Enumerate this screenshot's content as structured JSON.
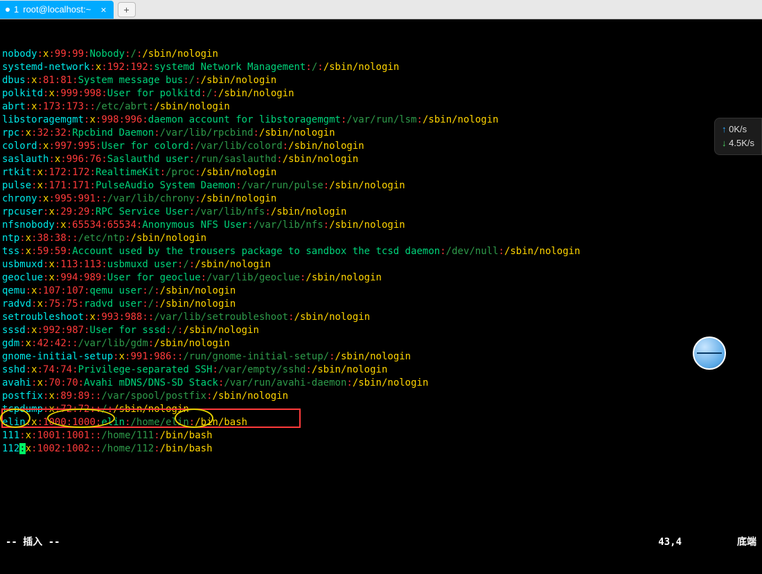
{
  "tab": {
    "index": "1",
    "title": "root@localhost:~",
    "close": "×",
    "plus": "+"
  },
  "lines": [
    [
      [
        "nobody",
        "cyan"
      ],
      [
        ":",
        "red"
      ],
      [
        "x",
        "yellow"
      ],
      [
        ":",
        "red"
      ],
      [
        "99",
        "red"
      ],
      [
        ":",
        "red"
      ],
      [
        "99",
        "red"
      ],
      [
        ":",
        "red"
      ],
      [
        "Nobody",
        "green"
      ],
      [
        ":",
        "red"
      ],
      [
        "/",
        "dgreen"
      ],
      [
        ":",
        "red"
      ],
      [
        "/sbin/nologin",
        "yellow"
      ]
    ],
    [
      [
        "systemd-network",
        "cyan"
      ],
      [
        ":",
        "red"
      ],
      [
        "x",
        "yellow"
      ],
      [
        ":",
        "red"
      ],
      [
        "192",
        "red"
      ],
      [
        ":",
        "red"
      ],
      [
        "192",
        "red"
      ],
      [
        ":",
        "red"
      ],
      [
        "systemd Network Management",
        "green"
      ],
      [
        ":",
        "red"
      ],
      [
        "/",
        "dgreen"
      ],
      [
        ":",
        "red"
      ],
      [
        "/sbin/nologin",
        "yellow"
      ]
    ],
    [
      [
        "dbus",
        "cyan"
      ],
      [
        ":",
        "red"
      ],
      [
        "x",
        "yellow"
      ],
      [
        ":",
        "red"
      ],
      [
        "81",
        "red"
      ],
      [
        ":",
        "red"
      ],
      [
        "81",
        "red"
      ],
      [
        ":",
        "red"
      ],
      [
        "System message bus",
        "green"
      ],
      [
        ":",
        "red"
      ],
      [
        "/",
        "dgreen"
      ],
      [
        ":",
        "red"
      ],
      [
        "/sbin/nologin",
        "yellow"
      ]
    ],
    [
      [
        "polkitd",
        "cyan"
      ],
      [
        ":",
        "red"
      ],
      [
        "x",
        "yellow"
      ],
      [
        ":",
        "red"
      ],
      [
        "999",
        "red"
      ],
      [
        ":",
        "red"
      ],
      [
        "998",
        "red"
      ],
      [
        ":",
        "red"
      ],
      [
        "User for polkitd",
        "green"
      ],
      [
        ":",
        "red"
      ],
      [
        "/",
        "dgreen"
      ],
      [
        ":",
        "red"
      ],
      [
        "/sbin/nologin",
        "yellow"
      ]
    ],
    [
      [
        "abrt",
        "cyan"
      ],
      [
        ":",
        "red"
      ],
      [
        "x",
        "yellow"
      ],
      [
        ":",
        "red"
      ],
      [
        "173",
        "red"
      ],
      [
        ":",
        "red"
      ],
      [
        "173",
        "red"
      ],
      [
        ":",
        "red"
      ],
      [
        ":",
        "red"
      ],
      [
        "/etc/abrt",
        "dgreen"
      ],
      [
        ":",
        "red"
      ],
      [
        "/sbin/nologin",
        "yellow"
      ]
    ],
    [
      [
        "libstoragemgmt",
        "cyan"
      ],
      [
        ":",
        "red"
      ],
      [
        "x",
        "yellow"
      ],
      [
        ":",
        "red"
      ],
      [
        "998",
        "red"
      ],
      [
        ":",
        "red"
      ],
      [
        "996",
        "red"
      ],
      [
        ":",
        "red"
      ],
      [
        "daemon account for libstoragemgmt",
        "green"
      ],
      [
        ":",
        "red"
      ],
      [
        "/var/run/lsm",
        "dgreen"
      ],
      [
        ":",
        "red"
      ],
      [
        "/sbin/nologin",
        "yellow"
      ]
    ],
    [
      [
        "rpc",
        "cyan"
      ],
      [
        ":",
        "red"
      ],
      [
        "x",
        "yellow"
      ],
      [
        ":",
        "red"
      ],
      [
        "32",
        "red"
      ],
      [
        ":",
        "red"
      ],
      [
        "32",
        "red"
      ],
      [
        ":",
        "red"
      ],
      [
        "Rpcbind Daemon",
        "green"
      ],
      [
        ":",
        "red"
      ],
      [
        "/var/lib/rpcbind",
        "dgreen"
      ],
      [
        ":",
        "red"
      ],
      [
        "/sbin/nologin",
        "yellow"
      ]
    ],
    [
      [
        "colord",
        "cyan"
      ],
      [
        ":",
        "red"
      ],
      [
        "x",
        "yellow"
      ],
      [
        ":",
        "red"
      ],
      [
        "997",
        "red"
      ],
      [
        ":",
        "red"
      ],
      [
        "995",
        "red"
      ],
      [
        ":",
        "red"
      ],
      [
        "User for colord",
        "green"
      ],
      [
        ":",
        "red"
      ],
      [
        "/var/lib/colord",
        "dgreen"
      ],
      [
        ":",
        "red"
      ],
      [
        "/sbin/nologin",
        "yellow"
      ]
    ],
    [
      [
        "saslauth",
        "cyan"
      ],
      [
        ":",
        "red"
      ],
      [
        "x",
        "yellow"
      ],
      [
        ":",
        "red"
      ],
      [
        "996",
        "red"
      ],
      [
        ":",
        "red"
      ],
      [
        "76",
        "red"
      ],
      [
        ":",
        "red"
      ],
      [
        "Saslauthd user",
        "green"
      ],
      [
        ":",
        "red"
      ],
      [
        "/run/saslauthd",
        "dgreen"
      ],
      [
        ":",
        "red"
      ],
      [
        "/sbin/nologin",
        "yellow"
      ]
    ],
    [
      [
        "rtkit",
        "cyan"
      ],
      [
        ":",
        "red"
      ],
      [
        "x",
        "yellow"
      ],
      [
        ":",
        "red"
      ],
      [
        "172",
        "red"
      ],
      [
        ":",
        "red"
      ],
      [
        "172",
        "red"
      ],
      [
        ":",
        "red"
      ],
      [
        "RealtimeKit",
        "green"
      ],
      [
        ":",
        "red"
      ],
      [
        "/proc",
        "dgreen"
      ],
      [
        ":",
        "red"
      ],
      [
        "/sbin/nologin",
        "yellow"
      ]
    ],
    [
      [
        "pulse",
        "cyan"
      ],
      [
        ":",
        "red"
      ],
      [
        "x",
        "yellow"
      ],
      [
        ":",
        "red"
      ],
      [
        "171",
        "red"
      ],
      [
        ":",
        "red"
      ],
      [
        "171",
        "red"
      ],
      [
        ":",
        "red"
      ],
      [
        "PulseAudio System Daemon",
        "green"
      ],
      [
        ":",
        "red"
      ],
      [
        "/var/run/pulse",
        "dgreen"
      ],
      [
        ":",
        "red"
      ],
      [
        "/sbin/nologin",
        "yellow"
      ]
    ],
    [
      [
        "chrony",
        "cyan"
      ],
      [
        ":",
        "red"
      ],
      [
        "x",
        "yellow"
      ],
      [
        ":",
        "red"
      ],
      [
        "995",
        "red"
      ],
      [
        ":",
        "red"
      ],
      [
        "991",
        "red"
      ],
      [
        ":",
        "red"
      ],
      [
        ":",
        "red"
      ],
      [
        "/var/lib/chrony",
        "dgreen"
      ],
      [
        ":",
        "red"
      ],
      [
        "/sbin/nologin",
        "yellow"
      ]
    ],
    [
      [
        "rpcuser",
        "cyan"
      ],
      [
        ":",
        "red"
      ],
      [
        "x",
        "yellow"
      ],
      [
        ":",
        "red"
      ],
      [
        "29",
        "red"
      ],
      [
        ":",
        "red"
      ],
      [
        "29",
        "red"
      ],
      [
        ":",
        "red"
      ],
      [
        "RPC Service User",
        "green"
      ],
      [
        ":",
        "red"
      ],
      [
        "/var/lib/nfs",
        "dgreen"
      ],
      [
        ":",
        "red"
      ],
      [
        "/sbin/nologin",
        "yellow"
      ]
    ],
    [
      [
        "nfsnobody",
        "cyan"
      ],
      [
        ":",
        "red"
      ],
      [
        "x",
        "yellow"
      ],
      [
        ":",
        "red"
      ],
      [
        "65534",
        "red"
      ],
      [
        ":",
        "red"
      ],
      [
        "65534",
        "red"
      ],
      [
        ":",
        "red"
      ],
      [
        "Anonymous NFS User",
        "green"
      ],
      [
        ":",
        "red"
      ],
      [
        "/var/lib/nfs",
        "dgreen"
      ],
      [
        ":",
        "red"
      ],
      [
        "/sbin/nologin",
        "yellow"
      ]
    ],
    [
      [
        "ntp",
        "cyan"
      ],
      [
        ":",
        "red"
      ],
      [
        "x",
        "yellow"
      ],
      [
        ":",
        "red"
      ],
      [
        "38",
        "red"
      ],
      [
        ":",
        "red"
      ],
      [
        "38",
        "red"
      ],
      [
        ":",
        "red"
      ],
      [
        ":",
        "red"
      ],
      [
        "/etc/ntp",
        "dgreen"
      ],
      [
        ":",
        "red"
      ],
      [
        "/sbin/nologin",
        "yellow"
      ]
    ],
    [
      [
        "tss",
        "cyan"
      ],
      [
        ":",
        "red"
      ],
      [
        "x",
        "yellow"
      ],
      [
        ":",
        "red"
      ],
      [
        "59",
        "red"
      ],
      [
        ":",
        "red"
      ],
      [
        "59",
        "red"
      ],
      [
        ":",
        "red"
      ],
      [
        "Account used by the trousers package to sandbox the tcsd daemon",
        "green"
      ],
      [
        ":",
        "red"
      ],
      [
        "/dev/null",
        "dgreen"
      ],
      [
        ":",
        "red"
      ],
      [
        "/sbin/nologin",
        "yellow"
      ]
    ],
    [
      [
        "usbmuxd",
        "cyan"
      ],
      [
        ":",
        "red"
      ],
      [
        "x",
        "yellow"
      ],
      [
        ":",
        "red"
      ],
      [
        "113",
        "red"
      ],
      [
        ":",
        "red"
      ],
      [
        "113",
        "red"
      ],
      [
        ":",
        "red"
      ],
      [
        "usbmuxd user",
        "green"
      ],
      [
        ":",
        "red"
      ],
      [
        "/",
        "dgreen"
      ],
      [
        ":",
        "red"
      ],
      [
        "/sbin/nologin",
        "yellow"
      ]
    ],
    [
      [
        "geoclue",
        "cyan"
      ],
      [
        ":",
        "red"
      ],
      [
        "x",
        "yellow"
      ],
      [
        ":",
        "red"
      ],
      [
        "994",
        "red"
      ],
      [
        ":",
        "red"
      ],
      [
        "989",
        "red"
      ],
      [
        ":",
        "red"
      ],
      [
        "User for geoclue",
        "green"
      ],
      [
        ":",
        "red"
      ],
      [
        "/var/lib/geoclue",
        "dgreen"
      ],
      [
        ":",
        "red"
      ],
      [
        "/sbin/nologin",
        "yellow"
      ]
    ],
    [
      [
        "qemu",
        "cyan"
      ],
      [
        ":",
        "red"
      ],
      [
        "x",
        "yellow"
      ],
      [
        ":",
        "red"
      ],
      [
        "107",
        "red"
      ],
      [
        ":",
        "red"
      ],
      [
        "107",
        "red"
      ],
      [
        ":",
        "red"
      ],
      [
        "qemu user",
        "green"
      ],
      [
        ":",
        "red"
      ],
      [
        "/",
        "dgreen"
      ],
      [
        ":",
        "red"
      ],
      [
        "/sbin/nologin",
        "yellow"
      ]
    ],
    [
      [
        "radvd",
        "cyan"
      ],
      [
        ":",
        "red"
      ],
      [
        "x",
        "yellow"
      ],
      [
        ":",
        "red"
      ],
      [
        "75",
        "red"
      ],
      [
        ":",
        "red"
      ],
      [
        "75",
        "red"
      ],
      [
        ":",
        "red"
      ],
      [
        "radvd user",
        "green"
      ],
      [
        ":",
        "red"
      ],
      [
        "/",
        "dgreen"
      ],
      [
        ":",
        "red"
      ],
      [
        "/sbin/nologin",
        "yellow"
      ]
    ],
    [
      [
        "setroubleshoot",
        "cyan"
      ],
      [
        ":",
        "red"
      ],
      [
        "x",
        "yellow"
      ],
      [
        ":",
        "red"
      ],
      [
        "993",
        "red"
      ],
      [
        ":",
        "red"
      ],
      [
        "988",
        "red"
      ],
      [
        ":",
        "red"
      ],
      [
        ":",
        "red"
      ],
      [
        "/var/lib/setroubleshoot",
        "dgreen"
      ],
      [
        ":",
        "red"
      ],
      [
        "/sbin/nologin",
        "yellow"
      ]
    ],
    [
      [
        "sssd",
        "cyan"
      ],
      [
        ":",
        "red"
      ],
      [
        "x",
        "yellow"
      ],
      [
        ":",
        "red"
      ],
      [
        "992",
        "red"
      ],
      [
        ":",
        "red"
      ],
      [
        "987",
        "red"
      ],
      [
        ":",
        "red"
      ],
      [
        "User for sssd",
        "green"
      ],
      [
        ":",
        "red"
      ],
      [
        "/",
        "dgreen"
      ],
      [
        ":",
        "red"
      ],
      [
        "/sbin/nologin",
        "yellow"
      ]
    ],
    [
      [
        "gdm",
        "cyan"
      ],
      [
        ":",
        "red"
      ],
      [
        "x",
        "yellow"
      ],
      [
        ":",
        "red"
      ],
      [
        "42",
        "red"
      ],
      [
        ":",
        "red"
      ],
      [
        "42",
        "red"
      ],
      [
        ":",
        "red"
      ],
      [
        ":",
        "red"
      ],
      [
        "/var/lib/gdm",
        "dgreen"
      ],
      [
        ":",
        "red"
      ],
      [
        "/sbin/nologin",
        "yellow"
      ]
    ],
    [
      [
        "gnome-initial-setup",
        "cyan"
      ],
      [
        ":",
        "red"
      ],
      [
        "x",
        "yellow"
      ],
      [
        ":",
        "red"
      ],
      [
        "991",
        "red"
      ],
      [
        ":",
        "red"
      ],
      [
        "986",
        "red"
      ],
      [
        ":",
        "red"
      ],
      [
        ":",
        "red"
      ],
      [
        "/run/gnome-initial-setup/",
        "dgreen"
      ],
      [
        ":",
        "red"
      ],
      [
        "/sbin/nologin",
        "yellow"
      ]
    ],
    [
      [
        "sshd",
        "cyan"
      ],
      [
        ":",
        "red"
      ],
      [
        "x",
        "yellow"
      ],
      [
        ":",
        "red"
      ],
      [
        "74",
        "red"
      ],
      [
        ":",
        "red"
      ],
      [
        "74",
        "red"
      ],
      [
        ":",
        "red"
      ],
      [
        "Privilege-separated SSH",
        "green"
      ],
      [
        ":",
        "red"
      ],
      [
        "/var/empty/sshd",
        "dgreen"
      ],
      [
        ":",
        "red"
      ],
      [
        "/sbin/nologin",
        "yellow"
      ]
    ],
    [
      [
        "avahi",
        "cyan"
      ],
      [
        ":",
        "red"
      ],
      [
        "x",
        "yellow"
      ],
      [
        ":",
        "red"
      ],
      [
        "70",
        "red"
      ],
      [
        ":",
        "red"
      ],
      [
        "70",
        "red"
      ],
      [
        ":",
        "red"
      ],
      [
        "Avahi mDNS/DNS-SD Stack",
        "green"
      ],
      [
        ":",
        "red"
      ],
      [
        "/var/run/avahi-daemon",
        "dgreen"
      ],
      [
        ":",
        "red"
      ],
      [
        "/sbin/nologin",
        "yellow"
      ]
    ],
    [
      [
        "postfix",
        "cyan"
      ],
      [
        ":",
        "red"
      ],
      [
        "x",
        "yellow"
      ],
      [
        ":",
        "red"
      ],
      [
        "89",
        "red"
      ],
      [
        ":",
        "red"
      ],
      [
        "89",
        "red"
      ],
      [
        ":",
        "red"
      ],
      [
        ":",
        "red"
      ],
      [
        "/var/spool/postfix",
        "dgreen"
      ],
      [
        ":",
        "red"
      ],
      [
        "/sbin/nologin",
        "yellow"
      ]
    ],
    [
      [
        "tcpdump",
        "cyan"
      ],
      [
        ":",
        "red"
      ],
      [
        "x",
        "yellow"
      ],
      [
        ":",
        "red"
      ],
      [
        "72",
        "red"
      ],
      [
        ":",
        "red"
      ],
      [
        "72",
        "red"
      ],
      [
        ":",
        "red"
      ],
      [
        ":",
        "red"
      ],
      [
        "/",
        "dgreen"
      ],
      [
        ":",
        "red"
      ],
      [
        "/sbin/nologin",
        "yellow"
      ]
    ],
    [
      [
        "elin",
        "cyan"
      ],
      [
        ":",
        "red"
      ],
      [
        "x",
        "yellow"
      ],
      [
        ":",
        "red"
      ],
      [
        "1000",
        "red"
      ],
      [
        ":",
        "red"
      ],
      [
        "1000",
        "red"
      ],
      [
        ":",
        "red"
      ],
      [
        "elin",
        "green"
      ],
      [
        ":",
        "red"
      ],
      [
        "/home/elin",
        "dgreen"
      ],
      [
        ":",
        "red"
      ],
      [
        "/bin/bash",
        "yellow"
      ]
    ],
    [
      [
        "111",
        "cyan"
      ],
      [
        ":",
        "red"
      ],
      [
        "x",
        "yellow"
      ],
      [
        ":",
        "red"
      ],
      [
        "1001",
        "red"
      ],
      [
        ":",
        "red"
      ],
      [
        "1001",
        "red"
      ],
      [
        ":",
        "red"
      ],
      [
        ":",
        "red"
      ],
      [
        "/home/111",
        "dgreen"
      ],
      [
        ":",
        "red"
      ],
      [
        "/bin/bash",
        "yellow"
      ]
    ],
    [
      [
        "112",
        "cyan"
      ],
      [
        ":",
        "cursor"
      ],
      [
        "x",
        "yellow"
      ],
      [
        ":",
        "red"
      ],
      [
        "1002",
        "red"
      ],
      [
        ":",
        "red"
      ],
      [
        "1002",
        "red"
      ],
      [
        ":",
        "red"
      ],
      [
        ":",
        "red"
      ],
      [
        "/home/112",
        "dgreen"
      ],
      [
        ":",
        "red"
      ],
      [
        "/bin/bash",
        "yellow"
      ]
    ]
  ],
  "status": {
    "mode": "-- 插入 --",
    "pos": "43,4",
    "right": "底端"
  },
  "net": {
    "up": "0K/s",
    "down": "4.5K/s"
  }
}
